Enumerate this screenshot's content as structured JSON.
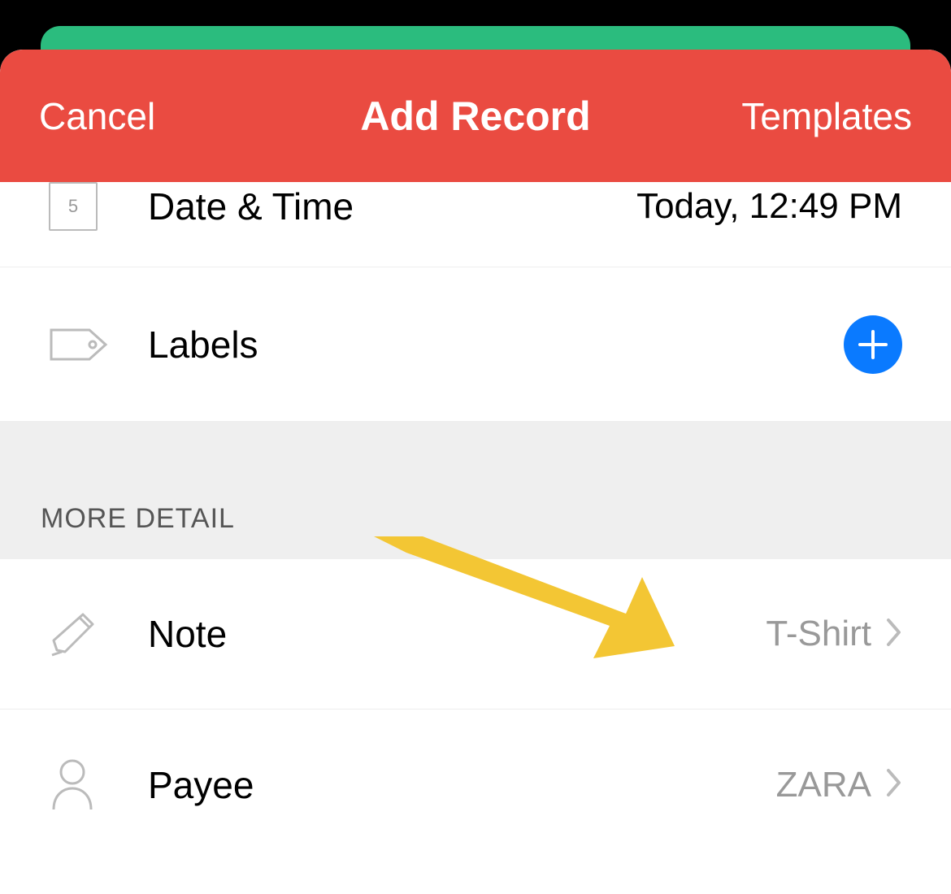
{
  "header": {
    "cancel_label": "Cancel",
    "title": "Add Record",
    "templates_label": "Templates"
  },
  "rows": {
    "datetime": {
      "label": "Date & Time",
      "value": "Today, 12:49 PM",
      "icon_day": "5"
    },
    "labels": {
      "label": "Labels"
    },
    "note": {
      "label": "Note",
      "value": "T-Shirt"
    },
    "payee": {
      "label": "Payee",
      "value": "ZARA"
    }
  },
  "section_header": "MORE DETAIL"
}
